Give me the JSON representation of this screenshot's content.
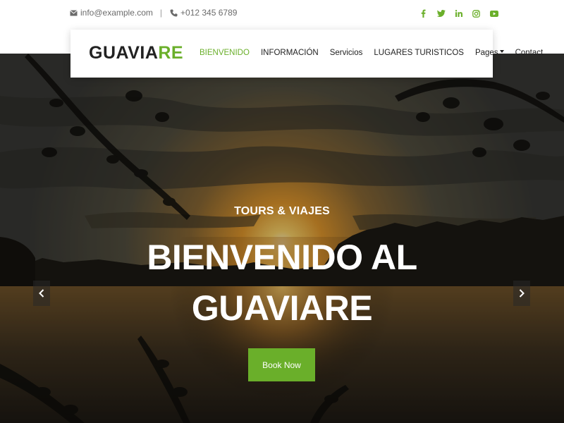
{
  "topbar": {
    "email": "info@example.com",
    "separator": "|",
    "phone": "+012 345 6789",
    "icons": [
      "envelope-icon",
      "phone-icon"
    ],
    "social": [
      "facebook-icon",
      "twitter-icon",
      "linkedin-icon",
      "instagram-icon",
      "youtube-icon"
    ],
    "social_color": "#6aaf2a"
  },
  "nav": {
    "logo_main": "GUAVIA",
    "logo_accent": "RE",
    "items": [
      {
        "label": "BIENVENIDO",
        "active": true
      },
      {
        "label": "INFORMACIÓN",
        "active": false
      },
      {
        "label": "Servicios",
        "active": false
      },
      {
        "label": "LUGARES TURISTICOS",
        "active": false
      },
      {
        "label": "Pages",
        "active": false,
        "dropdown": true
      },
      {
        "label": "Contact",
        "active": false
      }
    ],
    "accent_color": "#6aaf2a"
  },
  "hero": {
    "kicker": "TOURS & VIAJES",
    "title_line1": "BIENVENIDO AL",
    "title_line2": "GUAVIARE",
    "button": "Book Now",
    "prev_icon": "chevron-left-icon",
    "next_icon": "chevron-right-icon",
    "background": "sunset-river-photo"
  }
}
